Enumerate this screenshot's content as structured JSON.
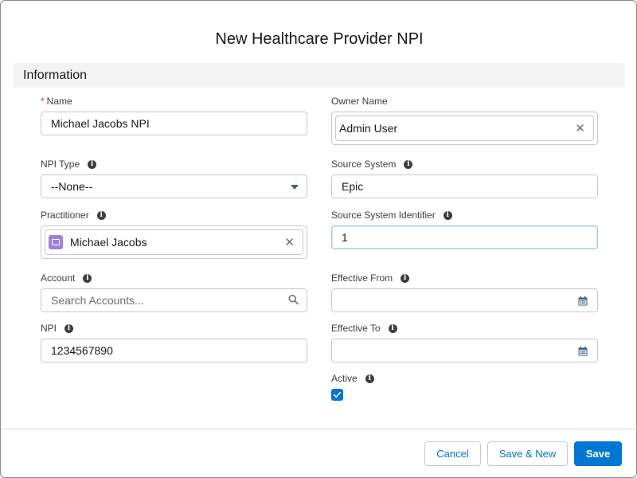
{
  "modal": {
    "title": "New Healthcare Provider NPI",
    "section_title": "Information"
  },
  "fields": {
    "name": {
      "label": "Name",
      "required_mark": "*",
      "value": "Michael Jacobs NPI"
    },
    "owner_name": {
      "label": "Owner Name",
      "value": "Admin User"
    },
    "npi_type": {
      "label": "NPI Type",
      "value": "--None--"
    },
    "source_system": {
      "label": "Source System",
      "value": "Epic"
    },
    "practitioner": {
      "label": "Practitioner",
      "value": "Michael Jacobs"
    },
    "source_system_identifier": {
      "label": "Source System Identifier",
      "value": "1"
    },
    "account": {
      "label": "Account",
      "placeholder": "Search Accounts..."
    },
    "effective_from": {
      "label": "Effective From",
      "value": ""
    },
    "npi": {
      "label": "NPI",
      "value": "1234567890"
    },
    "effective_to": {
      "label": "Effective To",
      "value": ""
    },
    "active": {
      "label": "Active",
      "checked": true
    }
  },
  "buttons": {
    "cancel": "Cancel",
    "save_new": "Save & New",
    "save": "Save"
  },
  "icons": {
    "info": "info-icon",
    "clear": "close-icon",
    "search": "search-icon",
    "calendar": "calendar-icon",
    "dropdown": "chevron-down-icon",
    "contact": "contact-card-icon",
    "check": "checkmark-icon"
  },
  "colors": {
    "brand": "#0176d3",
    "required": "#c23934",
    "section_bg": "#f3f3f3",
    "avatar": "#9e80e0"
  }
}
